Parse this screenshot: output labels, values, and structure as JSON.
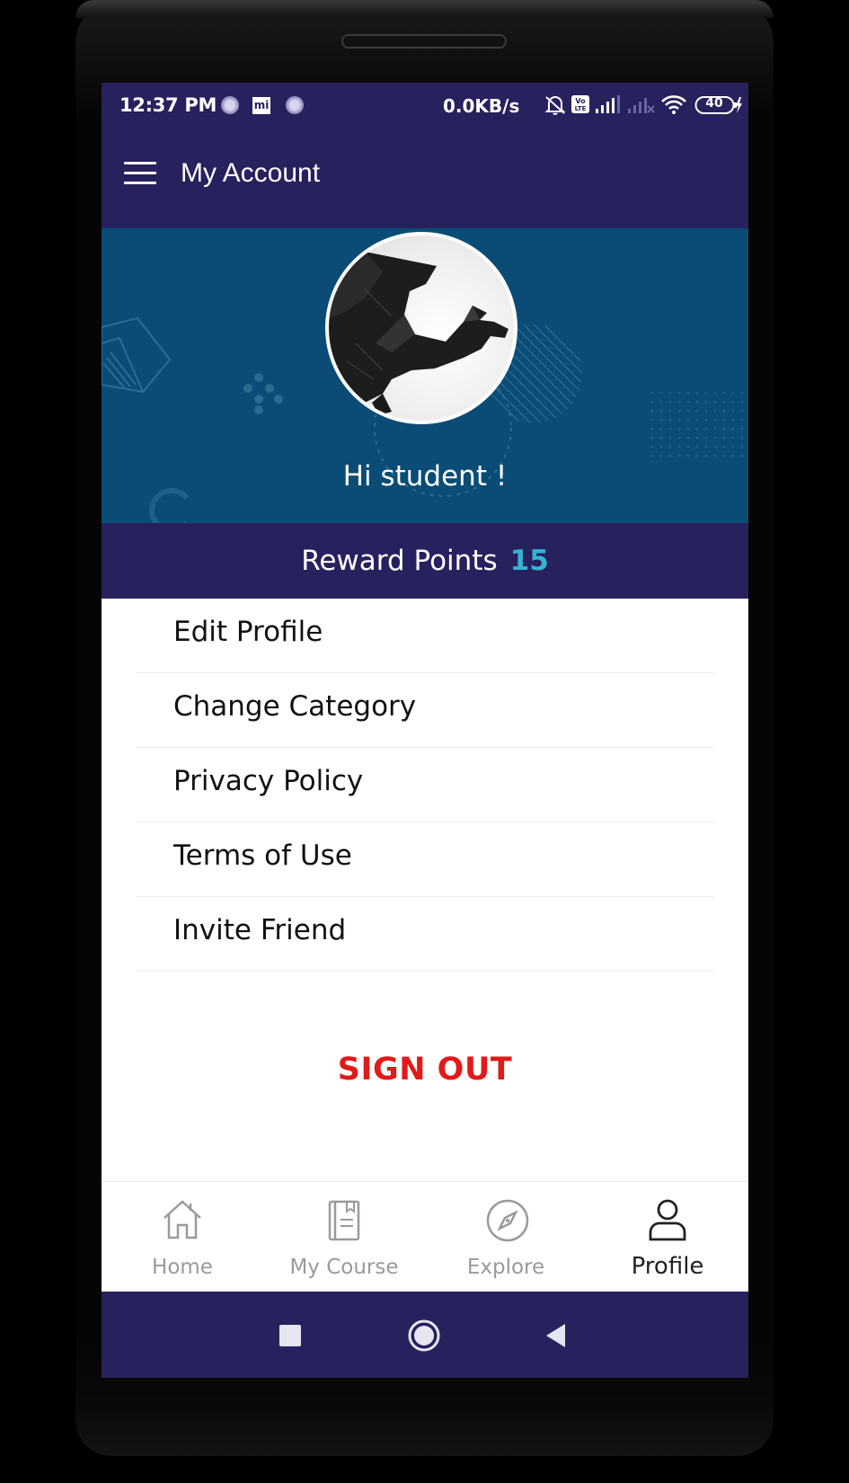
{
  "status_bar": {
    "time": "12:37 PM",
    "mi_label": "mi",
    "net_speed": "0.0KB/s",
    "battery": "40"
  },
  "app_bar": {
    "title": "My Account",
    "menu_icon": "hamburger-menu-icon"
  },
  "profile": {
    "greeting": "Hi student !",
    "header_color": "#0a4c75"
  },
  "reward": {
    "label": "Reward Points",
    "value": "15",
    "value_color": "#37b3d2"
  },
  "menu": {
    "items": [
      {
        "label": "Edit Profile"
      },
      {
        "label": "Change Category"
      },
      {
        "label": "Privacy Policy"
      },
      {
        "label": "Terms of Use"
      },
      {
        "label": "Invite Friend"
      }
    ]
  },
  "sign_out": {
    "label": "SIGN OUT",
    "color": "#e11a1a"
  },
  "bottom_nav": {
    "items": [
      {
        "label": "Home",
        "icon": "home-icon"
      },
      {
        "label": "My Course",
        "icon": "book-icon"
      },
      {
        "label": "Explore",
        "icon": "compass-icon"
      },
      {
        "label": "Profile",
        "icon": "user-icon",
        "active": true
      }
    ]
  },
  "theme": {
    "primary": "#27215e"
  }
}
